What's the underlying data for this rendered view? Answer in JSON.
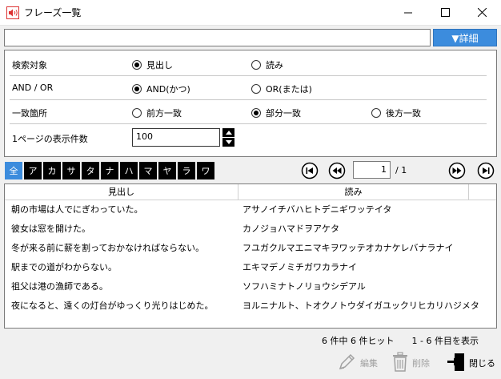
{
  "window": {
    "title": "フレーズ一覧"
  },
  "search": {
    "value": "",
    "placeholder": "",
    "detail_label": "▼詳細"
  },
  "options": {
    "target": {
      "label": "検索対象",
      "choices": [
        "見出し",
        "読み"
      ],
      "selected": 0
    },
    "andor": {
      "label": "AND / OR",
      "choices": [
        "AND(かつ)",
        "OR(または)"
      ],
      "selected": 0
    },
    "match": {
      "label": "一致箇所",
      "choices": [
        "前方一致",
        "部分一致",
        "後方一致"
      ],
      "selected": 1
    },
    "per_page": {
      "label": "1ページの表示件数",
      "value": "100"
    }
  },
  "letters": [
    "全",
    "ア",
    "カ",
    "サ",
    "タ",
    "ナ",
    "ハ",
    "マ",
    "ヤ",
    "ラ",
    "ワ"
  ],
  "pager": {
    "current": "1",
    "total_text": "/ 1"
  },
  "table": {
    "headers": [
      "見出し",
      "読み"
    ],
    "rows": [
      [
        "朝の市場は人でにぎわっていた。",
        "アサノイチバハヒトデニギワッテイタ"
      ],
      [
        "彼女は窓を開けた。",
        "カノジョハマドヲアケタ"
      ],
      [
        "冬が来る前に薪を割っておかなければならない。",
        "フユガクルマエニマキヲワッテオカナケレバナラナイ"
      ],
      [
        "駅までの道がわからない。",
        "エキマデノミチガワカラナイ"
      ],
      [
        "祖父は港の漁師である。",
        "ソフハミナトノリョウシデアル"
      ],
      [
        "夜になると、遠くの灯台がゆっくり光りはじめた。",
        "ヨルニナルト、トオクノトウダイガユックリヒカリハジメタ"
      ]
    ]
  },
  "status": {
    "text": "6 件中 6 件ヒット　　1 - 6 件目を表示"
  },
  "actions": {
    "edit": "編集",
    "delete": "削除",
    "close": "閉じる"
  },
  "colors": {
    "accent": "#3c8cdd"
  }
}
